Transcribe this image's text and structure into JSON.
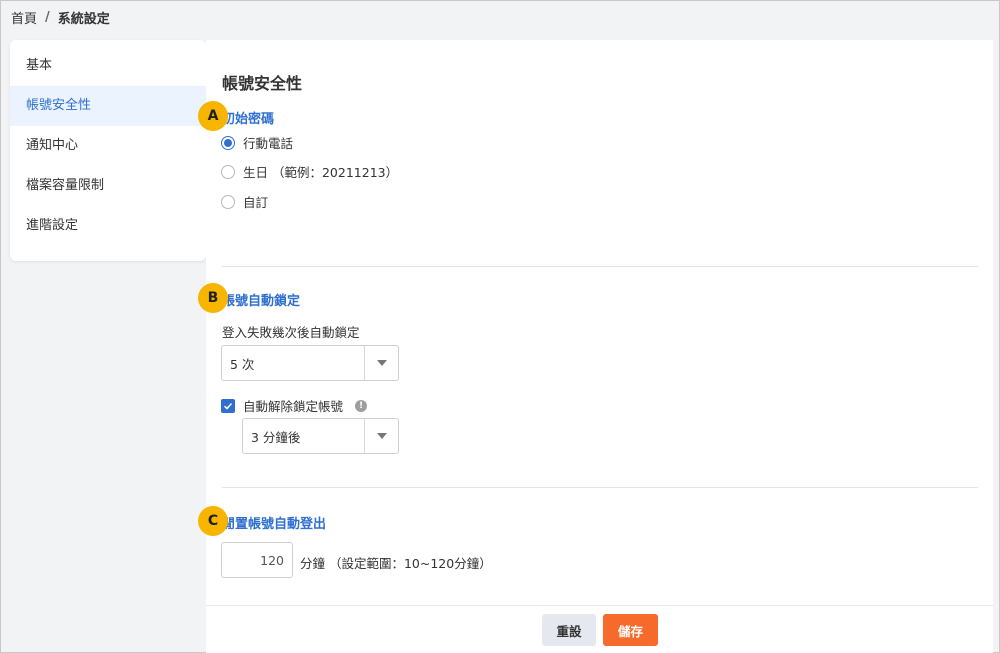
{
  "breadcrumb": {
    "home": "首頁",
    "separator": "/",
    "current": "系統設定"
  },
  "sidebar": {
    "items": [
      {
        "label": "基本"
      },
      {
        "label": "帳號安全性"
      },
      {
        "label": "通知中心"
      },
      {
        "label": "檔案容量限制"
      },
      {
        "label": "進階設定"
      }
    ],
    "active_index": 1
  },
  "page": {
    "title": "帳號安全性"
  },
  "section_a": {
    "marker": "A",
    "title": "初始密碼",
    "options": [
      {
        "label": "行動電話",
        "checked": true
      },
      {
        "label": "生日 （範例：20211213）",
        "checked": false
      },
      {
        "label": "自訂",
        "checked": false
      }
    ]
  },
  "section_b": {
    "marker": "B",
    "title": "帳號自動鎖定",
    "field_label": "登入失敗幾次後自動鎖定",
    "attempts_value": "5 次",
    "auto_unlock_label": "自動解除鎖定帳號",
    "auto_unlock_checked": true,
    "info_icon": "!",
    "unlock_after_value": "3 分鐘後"
  },
  "section_c": {
    "marker": "C",
    "title": "閒置帳號自動登出",
    "minutes_value": "120",
    "unit_text": "分鐘 （設定範圍：10~120分鐘）"
  },
  "footer": {
    "reset_label": "重設",
    "save_label": "儲存"
  },
  "colors": {
    "accent": "#2f6fd1",
    "marker": "#f7b500",
    "save": "#f66a2b"
  }
}
